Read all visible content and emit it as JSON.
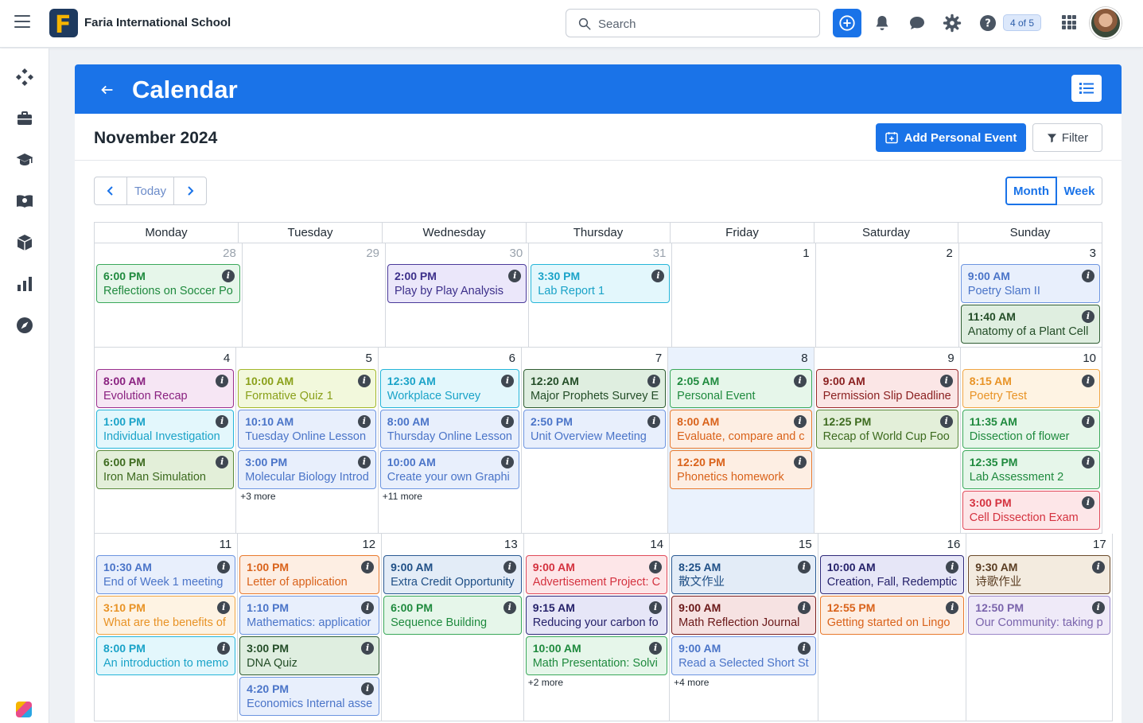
{
  "header": {
    "school_name": "Faria International School",
    "search_placeholder": "Search",
    "counter": "4 of 5"
  },
  "panel": {
    "title": "Calendar",
    "month_title": "November 2024",
    "add_event_label": "Add Personal Event",
    "filter_label": "Filter",
    "today_label": "Today",
    "view_month_label": "Month",
    "view_week_label": "Week"
  },
  "calendar": {
    "weekdays": [
      "Monday",
      "Tuesday",
      "Wednesday",
      "Thursday",
      "Friday",
      "Saturday",
      "Sunday"
    ],
    "weeks": [
      {
        "height": 132,
        "days": [
          {
            "num": "28",
            "muted": true,
            "events": [
              {
                "time": "6:00 PM",
                "title": "Reflections on Soccer Po",
                "color": "green"
              }
            ]
          },
          {
            "num": "29",
            "muted": true,
            "events": []
          },
          {
            "num": "30",
            "muted": true,
            "events": [
              {
                "time": "2:00 PM",
                "title": "Play by Play Analysis",
                "color": "purple"
              }
            ]
          },
          {
            "num": "31",
            "muted": true,
            "events": [
              {
                "time": "3:30 PM",
                "title": "Lab Report 1",
                "color": "cyan"
              }
            ]
          },
          {
            "num": "1",
            "events": []
          },
          {
            "num": "2",
            "events": []
          },
          {
            "num": "3",
            "events": [
              {
                "time": "9:00 AM",
                "title": "Poetry Slam II",
                "color": "blue"
              },
              {
                "time": "11:40 AM",
                "title": "Anatomy of a Plant Cell",
                "color": "darkgreen"
              }
            ]
          }
        ]
      },
      {
        "height": 234,
        "days": [
          {
            "num": "4",
            "events": [
              {
                "time": "8:00 AM",
                "title": "Evolution Recap",
                "color": "magenta"
              },
              {
                "time": "1:00 PM",
                "title": "Individual Investigation",
                "color": "cyan"
              },
              {
                "time": "6:00 PM",
                "title": "Iron Man Simulation",
                "color": "olivegreen"
              }
            ]
          },
          {
            "num": "5",
            "events": [
              {
                "time": "10:00 AM",
                "title": "Formative Quiz 1",
                "color": "yellowgreen"
              },
              {
                "time": "10:10 AM",
                "title": "Tuesday Online Lesson",
                "color": "blue"
              },
              {
                "time": "3:00 PM",
                "title": "Molecular Biology Introd",
                "color": "blue"
              }
            ],
            "more": "+3 more"
          },
          {
            "num": "6",
            "events": [
              {
                "time": "12:30 AM",
                "title": "Workplace Survey",
                "color": "cyan"
              },
              {
                "time": "8:00 AM",
                "title": "Thursday Online Lesson",
                "color": "blue"
              },
              {
                "time": "10:00 AM",
                "title": "Create your own Graphi",
                "color": "blue"
              }
            ],
            "more": "+11 more"
          },
          {
            "num": "7",
            "events": [
              {
                "time": "12:20 AM",
                "title": "Major Prophets Survey E",
                "color": "darkgreen"
              },
              {
                "time": "2:50 PM",
                "title": "Unit Overview Meeting",
                "color": "blue"
              }
            ]
          },
          {
            "num": "8",
            "today": true,
            "events": [
              {
                "time": "2:05 AM",
                "title": "Personal Event",
                "color": "green"
              },
              {
                "time": "8:00 AM",
                "title": "Evaluate, compare and c",
                "color": "orange"
              },
              {
                "time": "12:20 PM",
                "title": "Phonetics homework",
                "color": "orange"
              }
            ]
          },
          {
            "num": "9",
            "events": [
              {
                "time": "9:00 AM",
                "title": "Permission Slip Deadline",
                "color": "red"
              },
              {
                "time": "12:25 PM",
                "title": "Recap of World Cup Foo",
                "color": "olivegreen"
              }
            ]
          },
          {
            "num": "10",
            "events": [
              {
                "time": "8:15 AM",
                "title": "Poetry Test",
                "color": "amber"
              },
              {
                "time": "11:35 AM",
                "title": "Dissection of flower",
                "color": "green"
              },
              {
                "time": "12:35 PM",
                "title": "Lab Assessment 2",
                "color": "green"
              },
              {
                "time": "3:00 PM",
                "title": "Cell Dissection Exam",
                "color": "rose"
              }
            ]
          }
        ]
      },
      {
        "height": 236,
        "days": [
          {
            "num": "11",
            "events": [
              {
                "time": "10:30 AM",
                "title": "End of Week 1 meeting",
                "color": "blue"
              },
              {
                "time": "3:10 PM",
                "title": "What are the benefits of",
                "color": "amber"
              },
              {
                "time": "8:00 PM",
                "title": "An introduction to memo",
                "color": "cyan"
              }
            ]
          },
          {
            "num": "12",
            "events": [
              {
                "time": "1:00 PM",
                "title": "Letter of application",
                "color": "orange"
              },
              {
                "time": "1:10 PM",
                "title": "Mathematics: applicatior",
                "color": "blue"
              },
              {
                "time": "3:00 PM",
                "title": "DNA Quiz",
                "color": "darkgreen"
              },
              {
                "time": "4:20 PM",
                "title": "Economics Internal asse",
                "color": "blue"
              }
            ]
          },
          {
            "num": "13",
            "events": [
              {
                "time": "9:00 AM",
                "title": "Extra Credit Opportunity",
                "color": "navy"
              },
              {
                "time": "6:00 PM",
                "title": "Sequence Building",
                "color": "green"
              }
            ]
          },
          {
            "num": "14",
            "events": [
              {
                "time": "9:00 AM",
                "title": "Advertisement Project: C",
                "color": "rose"
              },
              {
                "time": "9:15 AM",
                "title": "Reducing your carbon fo",
                "color": "indigo"
              },
              {
                "time": "10:00 AM",
                "title": "Math Presentation: Solvi",
                "color": "green"
              }
            ],
            "more": "+2 more"
          },
          {
            "num": "15",
            "events": [
              {
                "time": "8:25 AM",
                "title": "散文作业",
                "color": "navy"
              },
              {
                "time": "9:00 AM",
                "title": "Math Reflection Journal",
                "color": "maroon"
              },
              {
                "time": "9:00 AM",
                "title": "Read a Selected Short St",
                "color": "blue"
              }
            ],
            "more": "+4 more"
          },
          {
            "num": "16",
            "events": [
              {
                "time": "10:00 AM",
                "title": "Creation, Fall, Redemptic",
                "color": "indigo"
              },
              {
                "time": "12:55 PM",
                "title": "Getting started on Lingo",
                "color": "orange"
              }
            ]
          },
          {
            "num": "17",
            "events": [
              {
                "time": "9:30 AM",
                "title": "诗歌作业",
                "color": "brown"
              },
              {
                "time": "12:50 PM",
                "title": "Our Community: taking p",
                "color": "lavender"
              }
            ]
          }
        ]
      }
    ]
  },
  "event_colors": {
    "green": {
      "bg": "#e6f6ea",
      "border": "#3aa85a",
      "text": "#1f8a3e"
    },
    "darkgreen": {
      "bg": "#dfeee0",
      "border": "#2f5d33",
      "text": "#234d27"
    },
    "olivegreen": {
      "bg": "#e3efd9",
      "border": "#5a8a3c",
      "text": "#3d6b1f"
    },
    "yellowgreen": {
      "bg": "#f2f8dc",
      "border": "#a3b82c",
      "text": "#8aa01a"
    },
    "purple": {
      "bg": "#ebe7fa",
      "border": "#4a3a9a",
      "text": "#3c2f8a"
    },
    "indigo": {
      "bg": "#e6e6f7",
      "border": "#2f2a7a",
      "text": "#25216a"
    },
    "lavender": {
      "bg": "#efeaf8",
      "border": "#9a86c8",
      "text": "#7a64ac"
    },
    "cyan": {
      "bg": "#e3f7fc",
      "border": "#25b5d9",
      "text": "#1aa3c8"
    },
    "blue": {
      "bg": "#e8effc",
      "border": "#6d95e0",
      "text": "#4a74c8"
    },
    "navy": {
      "bg": "#e3ecf7",
      "border": "#2a5a93",
      "text": "#1f4f86"
    },
    "magenta": {
      "bg": "#f6e6f4",
      "border": "#9a2f8e",
      "text": "#8a2280"
    },
    "orange": {
      "bg": "#fdeee3",
      "border": "#e87a2e",
      "text": "#d9621a"
    },
    "amber": {
      "bg": "#fef3e3",
      "border": "#f0a544",
      "text": "#e89326"
    },
    "red": {
      "bg": "#fbe6e6",
      "border": "#9a2a2a",
      "text": "#8a1f1f"
    },
    "rose": {
      "bg": "#fde6e8",
      "border": "#e04a5a",
      "text": "#d4323f"
    },
    "maroon": {
      "bg": "#f6e2e2",
      "border": "#7a2020",
      "text": "#6a1818"
    },
    "brown": {
      "bg": "#f3ebdf",
      "border": "#6b4a2a",
      "text": "#5a3d22"
    }
  },
  "colors": {
    "accent": "#1a73e8",
    "today_bg": "#eaf2fd"
  }
}
